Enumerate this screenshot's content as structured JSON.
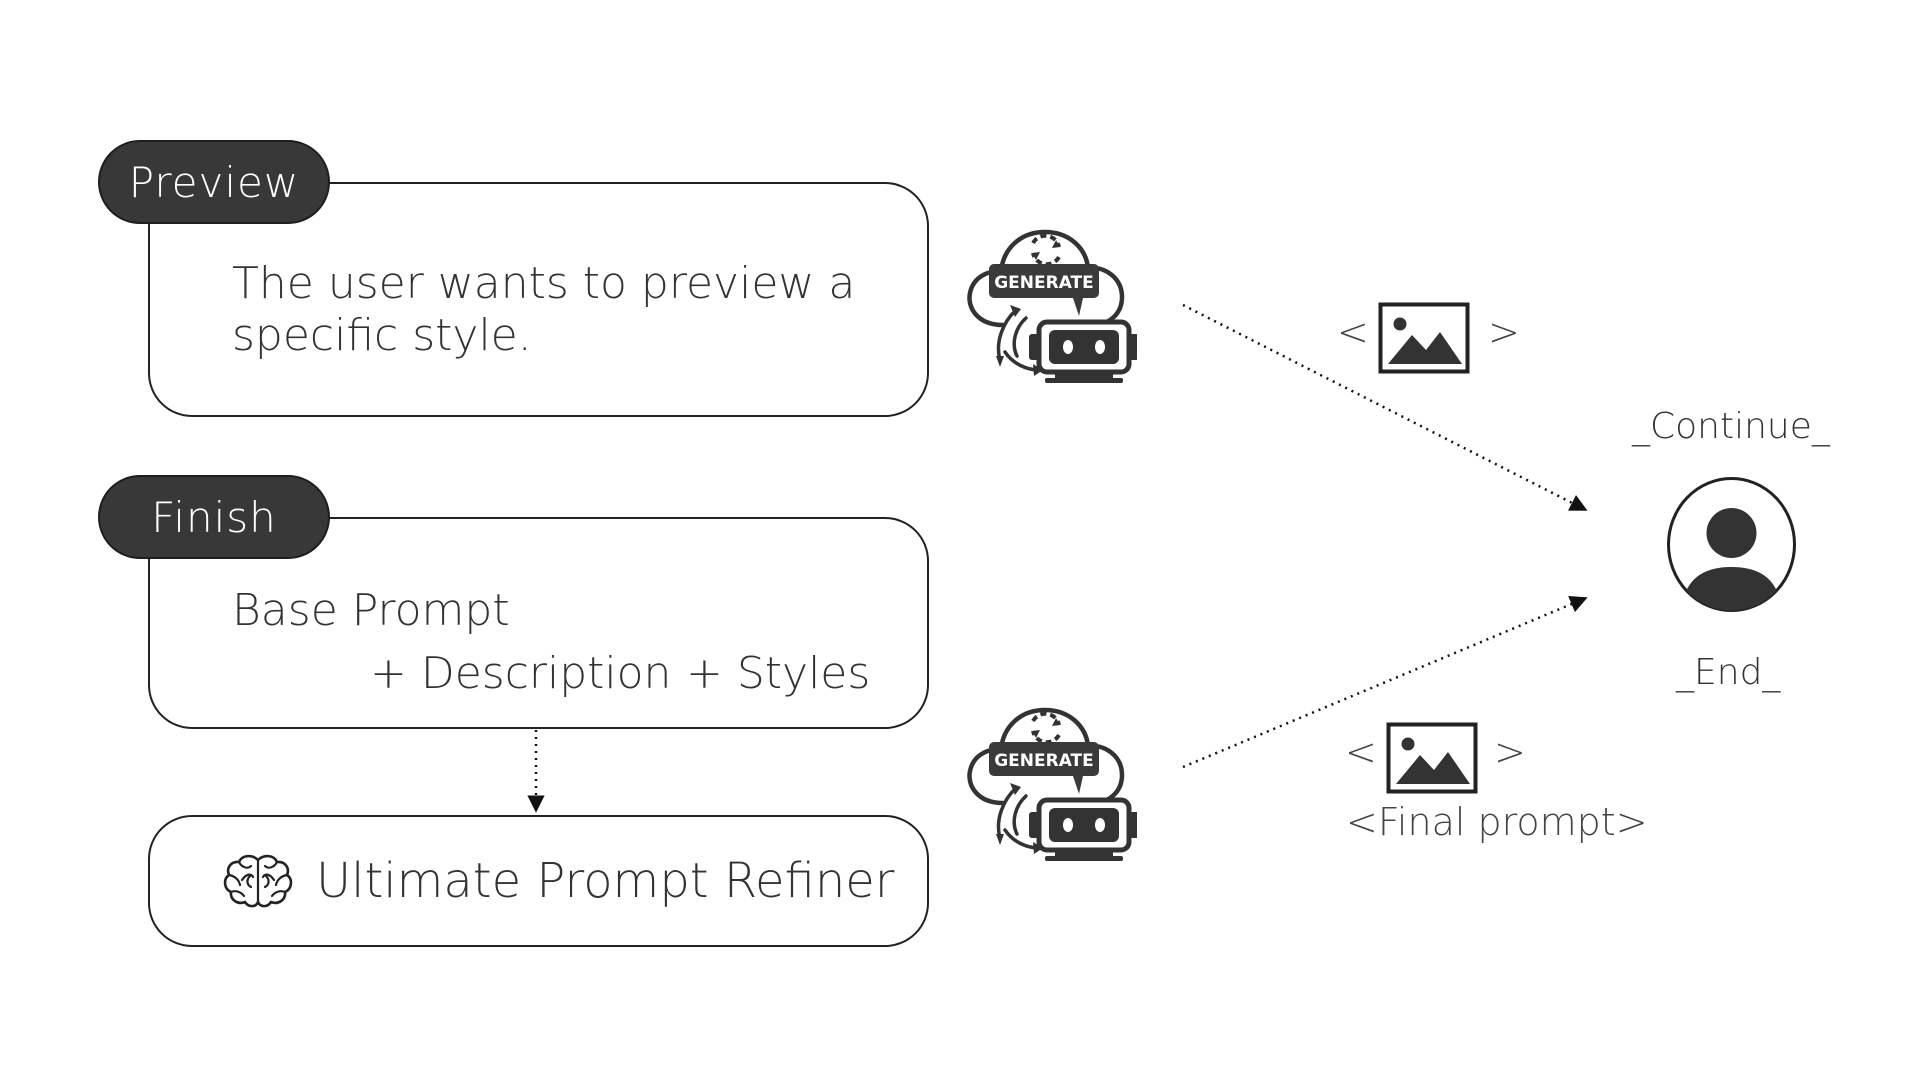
{
  "preview": {
    "tag": "Preview",
    "description": "The user wants to preview a specific style."
  },
  "finish": {
    "tag": "Finish",
    "base": "Base Prompt",
    "plus_description": "+ Description",
    "plus_styles": "+ Styles"
  },
  "refiner": {
    "label": "Ultimate Prompt Refiner",
    "icon": "brain-icon"
  },
  "generate": {
    "label": "GENERATE",
    "icon": "cloud-robot-generate-icon"
  },
  "outputs": {
    "image_icon": "image-placeholder-icon",
    "left_bracket": "<",
    "right_bracket": ">",
    "final_prompt": "<Final prompt>"
  },
  "user": {
    "icon": "user-avatar-icon",
    "continue": "_Continue_",
    "end": "_End_"
  },
  "colors": {
    "tag_fill": "#383838",
    "line": "#222222",
    "text": "#333333",
    "background": "#ffffff"
  }
}
